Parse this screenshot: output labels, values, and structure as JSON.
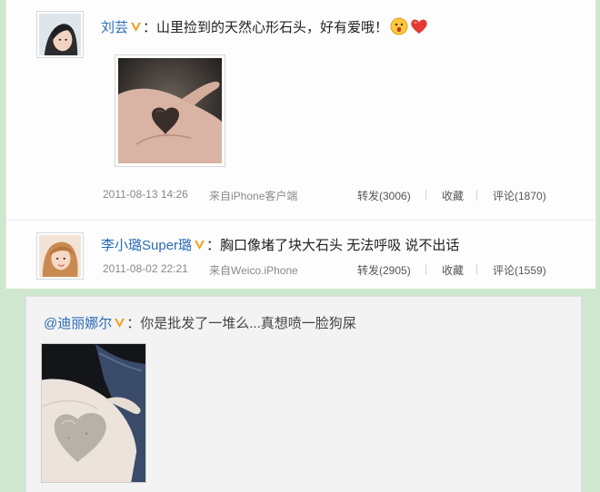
{
  "posts": [
    {
      "author": "刘芸",
      "text": "：山里捡到的天然心形石头，好有爱哦！",
      "time": "2011-08-13 14:26",
      "source": "来自iPhone客户端",
      "repost": "转发(3006)",
      "favorite": "收藏",
      "comment": "评论(1870)"
    },
    {
      "author": "李小璐Super璐",
      "text": "：胸口像堵了块大石头 无法呼吸 说不出话",
      "time": "2011-08-02 22:21",
      "source": "来自Weico.iPhone",
      "repost": "转发(2905)",
      "favorite": "收藏",
      "comment": "评论(1559)"
    }
  ],
  "reply": {
    "author": "@迪丽娜尔",
    "text": "：你是批发了一堆么...真想喷一脸狗屎"
  },
  "colors": {
    "name_link": "#2a6cb5",
    "verified_badge": "#f0a020",
    "heart": "#e53935"
  },
  "icons": [
    "verified-badge-icon",
    "surprised-emoji-icon",
    "heart-emoji-icon"
  ]
}
